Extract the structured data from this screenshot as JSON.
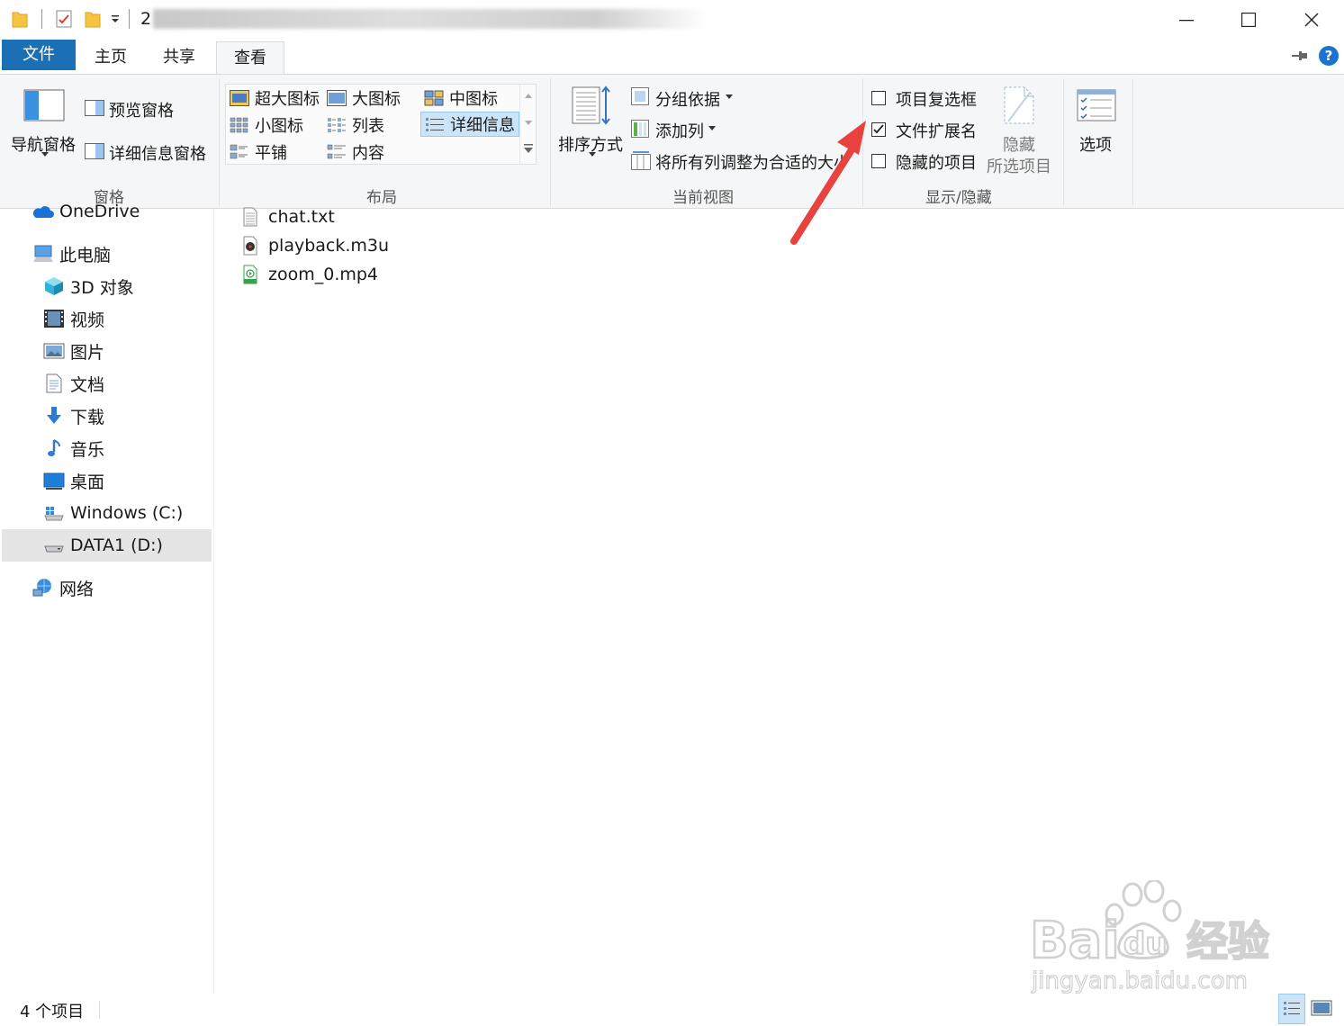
{
  "window": {
    "title": "2",
    "controls": {
      "minimize": "—",
      "maximize": "☐",
      "close": "✕"
    }
  },
  "tabs": {
    "file": "文件",
    "home": "主页",
    "share": "共享",
    "view": "查看"
  },
  "ribbon": {
    "panes": {
      "label": "窗格",
      "navigation_pane": "导航窗格",
      "preview_pane": "预览窗格",
      "details_pane": "详细信息窗格"
    },
    "layout": {
      "label": "布局",
      "items": [
        "超大图标",
        "大图标",
        "中图标",
        "小图标",
        "列表",
        "详细信息",
        "平铺",
        "内容"
      ],
      "selected": "详细信息"
    },
    "current_view": {
      "label": "当前视图",
      "sort_by": "排序方式",
      "group_by": "分组依据",
      "add_columns": "添加列",
      "size_all_columns": "将所有列调整为合适的大小"
    },
    "show_hide": {
      "label": "显示/隐藏",
      "item_checkboxes": {
        "text": "项目复选框",
        "checked": false
      },
      "file_extensions": {
        "text": "文件扩展名",
        "checked": true
      },
      "hidden_items": {
        "text": "隐藏的项目",
        "checked": false
      },
      "hide_selected_1": "隐藏",
      "hide_selected_2": "所选项目"
    },
    "options": "选项"
  },
  "nav": {
    "onedrive": "OneDrive",
    "this_pc": "此电脑",
    "objects3d": "3D 对象",
    "videos": "视频",
    "pictures": "图片",
    "documents": "文档",
    "downloads": "下载",
    "music": "音乐",
    "desktop": "桌面",
    "drive_c": "Windows (C:)",
    "drive_d": "DATA1 (D:)",
    "network": "网络"
  },
  "files": [
    {
      "name": "chat.txt",
      "icon": "text-file-icon"
    },
    {
      "name": "playback.m3u",
      "icon": "playlist-file-icon"
    },
    {
      "name": "zoom_0.mp4",
      "icon": "video-file-icon"
    }
  ],
  "status": {
    "count": "4 个项目"
  },
  "watermark": {
    "brand": "Bai du 经验",
    "url": "jingyan.baidu.com"
  },
  "colors": {
    "accent": "#1a6fb5",
    "ribbon_bg": "#f5f6f7",
    "selection": "#cce4f7",
    "annotation_arrow": "#e8423f"
  }
}
